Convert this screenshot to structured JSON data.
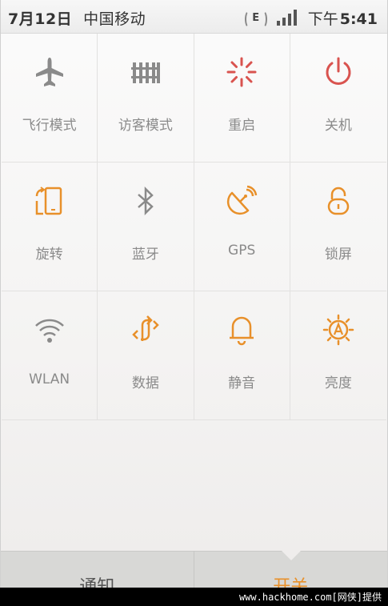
{
  "status_bar": {
    "date": "7月12日",
    "carrier": "中国移动",
    "network_type": "E",
    "time_prefix": "下午",
    "time": "5:41"
  },
  "colors": {
    "inactive": "#8a8a8a",
    "active": "#e8902a",
    "power": "#d9534f"
  },
  "toggles": [
    {
      "label": "飞行模式",
      "icon": "airplane-icon",
      "active": false
    },
    {
      "label": "访客模式",
      "icon": "guest-mode-icon",
      "active": false
    },
    {
      "label": "重启",
      "icon": "reboot-icon",
      "active": true
    },
    {
      "label": "关机",
      "icon": "power-icon",
      "active": true
    },
    {
      "label": "旋转",
      "icon": "rotate-icon",
      "active": true
    },
    {
      "label": "蓝牙",
      "icon": "bluetooth-icon",
      "active": false
    },
    {
      "label": "GPS",
      "icon": "gps-icon",
      "active": true
    },
    {
      "label": "锁屏",
      "icon": "lock-screen-icon",
      "active": true
    },
    {
      "label": "WLAN",
      "icon": "wifi-icon",
      "active": false
    },
    {
      "label": "数据",
      "icon": "data-icon",
      "active": true
    },
    {
      "label": "静音",
      "icon": "bell-icon",
      "active": true
    },
    {
      "label": "亮度",
      "icon": "brightness-auto-icon",
      "active": true
    }
  ],
  "tabs": {
    "notifications": "通知",
    "switches": "开关"
  },
  "watermark": "www.hackhome.com[网侠]提供"
}
